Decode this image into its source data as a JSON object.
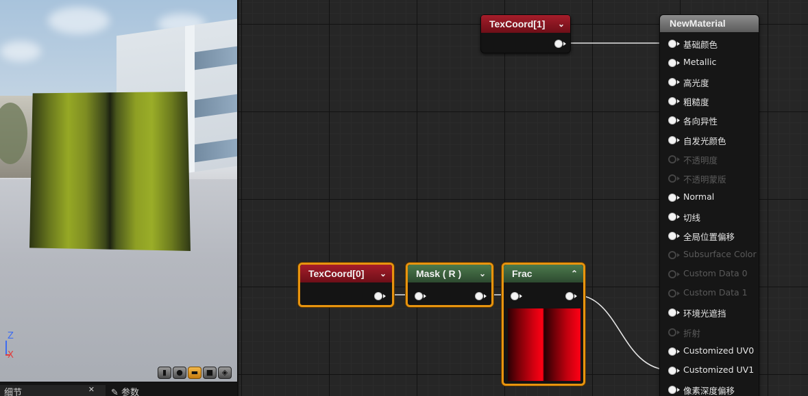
{
  "viewport": {
    "axis_z": "Z",
    "axis_x": "X",
    "preview_shapes": [
      "cylinder-icon",
      "sphere-icon",
      "plane-icon",
      "cube-icon",
      "teapot-icon"
    ]
  },
  "bottom_tabs": {
    "details_label": "细节",
    "params_label": "参数"
  },
  "nodes": {
    "texcoord1": {
      "title": "TexCoord[1]"
    },
    "texcoord0": {
      "title": "TexCoord[0]"
    },
    "mask": {
      "title": "Mask ( R )"
    },
    "frac": {
      "title": "Frac"
    }
  },
  "material": {
    "title": "NewMaterial",
    "inputs": [
      {
        "label": "基础颜色",
        "enabled": true
      },
      {
        "label": "Metallic",
        "enabled": true
      },
      {
        "label": "高光度",
        "enabled": true
      },
      {
        "label": "粗糙度",
        "enabled": true
      },
      {
        "label": "各向异性",
        "enabled": true
      },
      {
        "label": "自发光颜色",
        "enabled": true
      },
      {
        "label": "不透明度",
        "enabled": false
      },
      {
        "label": "不透明蒙版",
        "enabled": false
      },
      {
        "label": "Normal",
        "enabled": true
      },
      {
        "label": "切线",
        "enabled": true
      },
      {
        "label": "全局位置偏移",
        "enabled": true
      },
      {
        "label": "Subsurface Color",
        "enabled": false
      },
      {
        "label": "Custom Data 0",
        "enabled": false
      },
      {
        "label": "Custom Data 1",
        "enabled": false
      },
      {
        "label": "环境光遮挡",
        "enabled": true
      },
      {
        "label": "折射",
        "enabled": false
      },
      {
        "label": "Customized UV0",
        "enabled": true
      },
      {
        "label": "Customized UV1",
        "enabled": true
      },
      {
        "label": "像素深度偏移",
        "enabled": true
      }
    ]
  },
  "colors": {
    "selection": "#e8940f",
    "texcoord_header": "#a51d2a",
    "mask_header": "#4c7a4c",
    "wire": "#e6e6e6"
  }
}
